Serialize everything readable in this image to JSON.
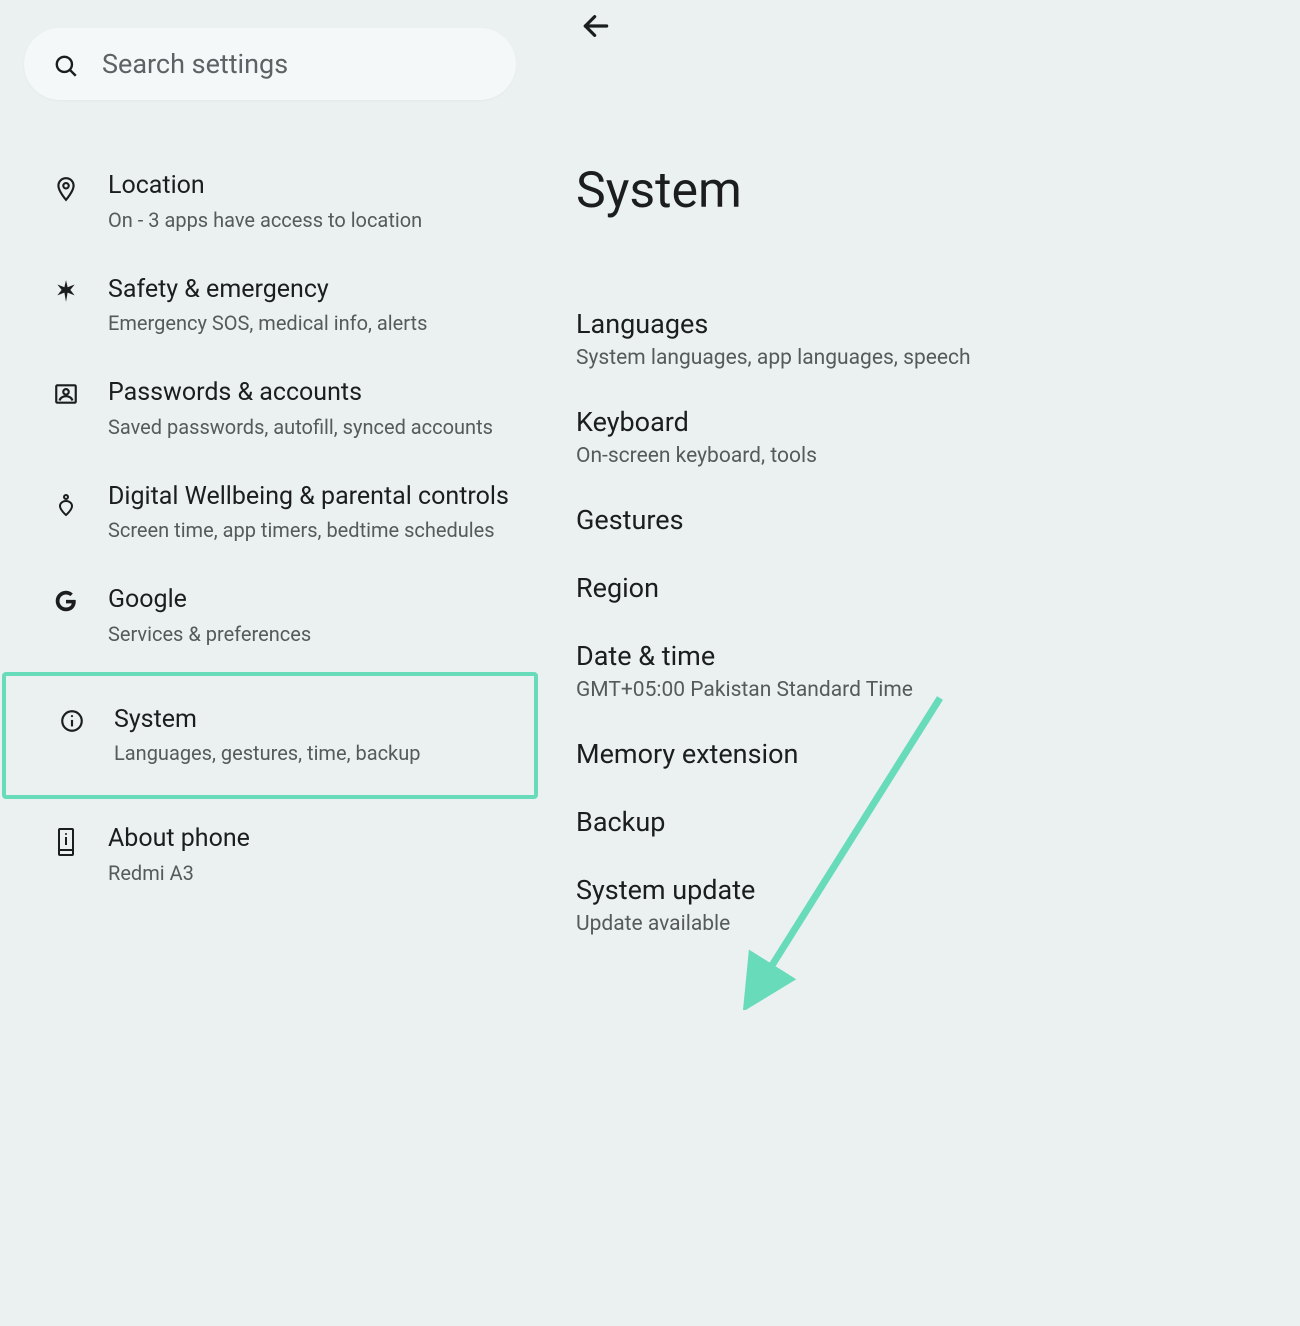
{
  "search": {
    "placeholder": "Search settings"
  },
  "left_items": [
    {
      "title": "Location",
      "sub": "On - 3 apps have access to location"
    },
    {
      "title": "Safety & emergency",
      "sub": "Emergency SOS, medical info, alerts"
    },
    {
      "title": "Passwords & accounts",
      "sub": "Saved passwords, autofill, synced accounts"
    },
    {
      "title": "Digital Wellbeing & parental controls",
      "sub": "Screen time, app timers, bedtime schedules"
    },
    {
      "title": "Google",
      "sub": "Services & preferences"
    },
    {
      "title": "System",
      "sub": "Languages, gestures, time, backup"
    },
    {
      "title": "About phone",
      "sub": "Redmi A3"
    }
  ],
  "right": {
    "title": "System",
    "items": [
      {
        "title": "Languages",
        "sub": "System languages, app languages, speech"
      },
      {
        "title": "Keyboard",
        "sub": "On-screen keyboard, tools"
      },
      {
        "title": "Gestures",
        "sub": ""
      },
      {
        "title": "Region",
        "sub": ""
      },
      {
        "title": "Date & time",
        "sub": "GMT+05:00 Pakistan Standard Time"
      },
      {
        "title": "Memory extension",
        "sub": ""
      },
      {
        "title": "Backup",
        "sub": ""
      },
      {
        "title": "System update",
        "sub": "Update available"
      }
    ]
  },
  "annotations": {
    "highlight_left_index": 5,
    "arrow_color": "#68dbbb"
  }
}
